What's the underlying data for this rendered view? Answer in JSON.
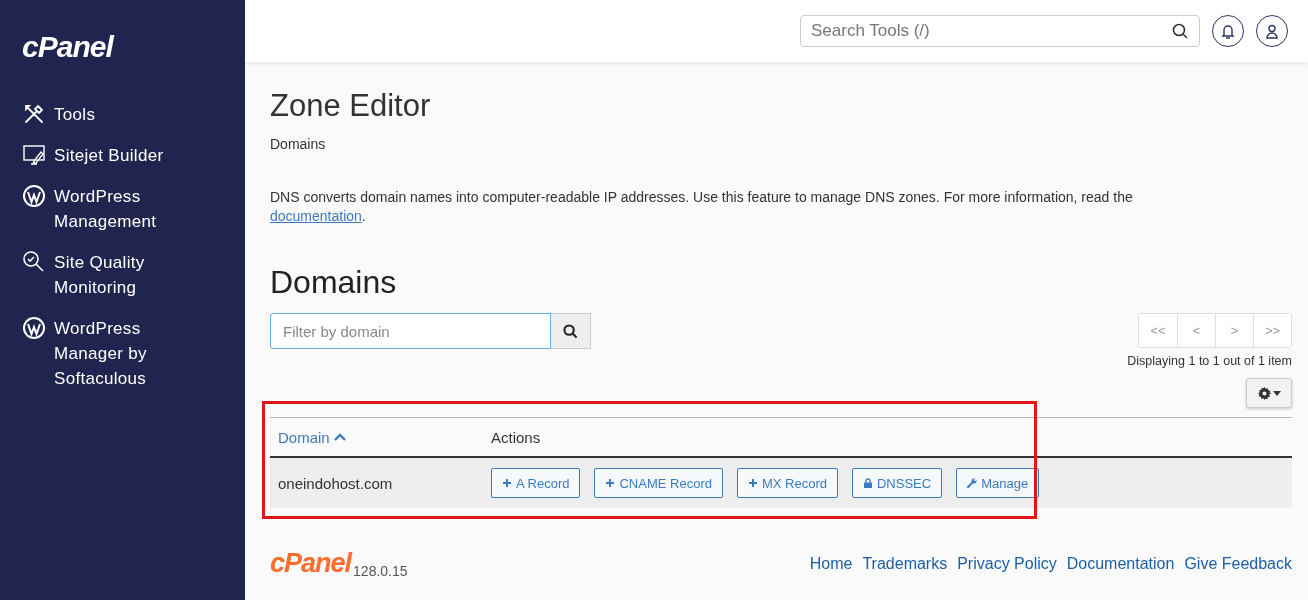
{
  "sidebar": {
    "logo": "cPanel",
    "items": [
      {
        "label": "Tools",
        "kind": "tools"
      },
      {
        "label": "Sitejet Builder",
        "kind": "monitor"
      },
      {
        "label": "WordPress Management",
        "kind": "wordpress"
      },
      {
        "label": "Site Quality Monitoring",
        "kind": "quality"
      },
      {
        "label": "WordPress Manager by Softaculous",
        "kind": "wordpress"
      }
    ]
  },
  "topbar": {
    "search": {
      "placeholder": "Search Tools (/)"
    }
  },
  "page": {
    "title": "Zone Editor",
    "breadcrumb": "Domains",
    "intro": {
      "text": "DNS converts domain names into computer-readable IP addresses. Use this feature to manage DNS zones. For more information, read the",
      "link": "documentation",
      "after": "."
    },
    "section": "Domains",
    "filter": {
      "placeholder": "Filter by domain"
    },
    "pagination": [
      "<<",
      "<",
      ">",
      ">>"
    ],
    "status": "Displaying 1 to 1 out of 1 item",
    "table": {
      "columns": [
        {
          "label": "Domain",
          "sorted": true
        },
        {
          "label": "Actions",
          "sorted": false
        }
      ],
      "rows": [
        {
          "domain": "oneindohost.com",
          "actions": [
            {
              "label": "A Record",
              "kind": "plus"
            },
            {
              "label": "CNAME Record",
              "kind": "plus"
            },
            {
              "label": "MX Record",
              "kind": "plus"
            },
            {
              "label": "DNSSEC",
              "kind": "lock"
            },
            {
              "label": "Manage",
              "kind": "wrench"
            }
          ]
        }
      ]
    }
  },
  "footer": {
    "logo": "cPanel",
    "version": "128.0.15",
    "links": [
      "Home",
      "Trademarks",
      "Privacy Policy",
      "Documentation",
      "Give Feedback"
    ]
  }
}
